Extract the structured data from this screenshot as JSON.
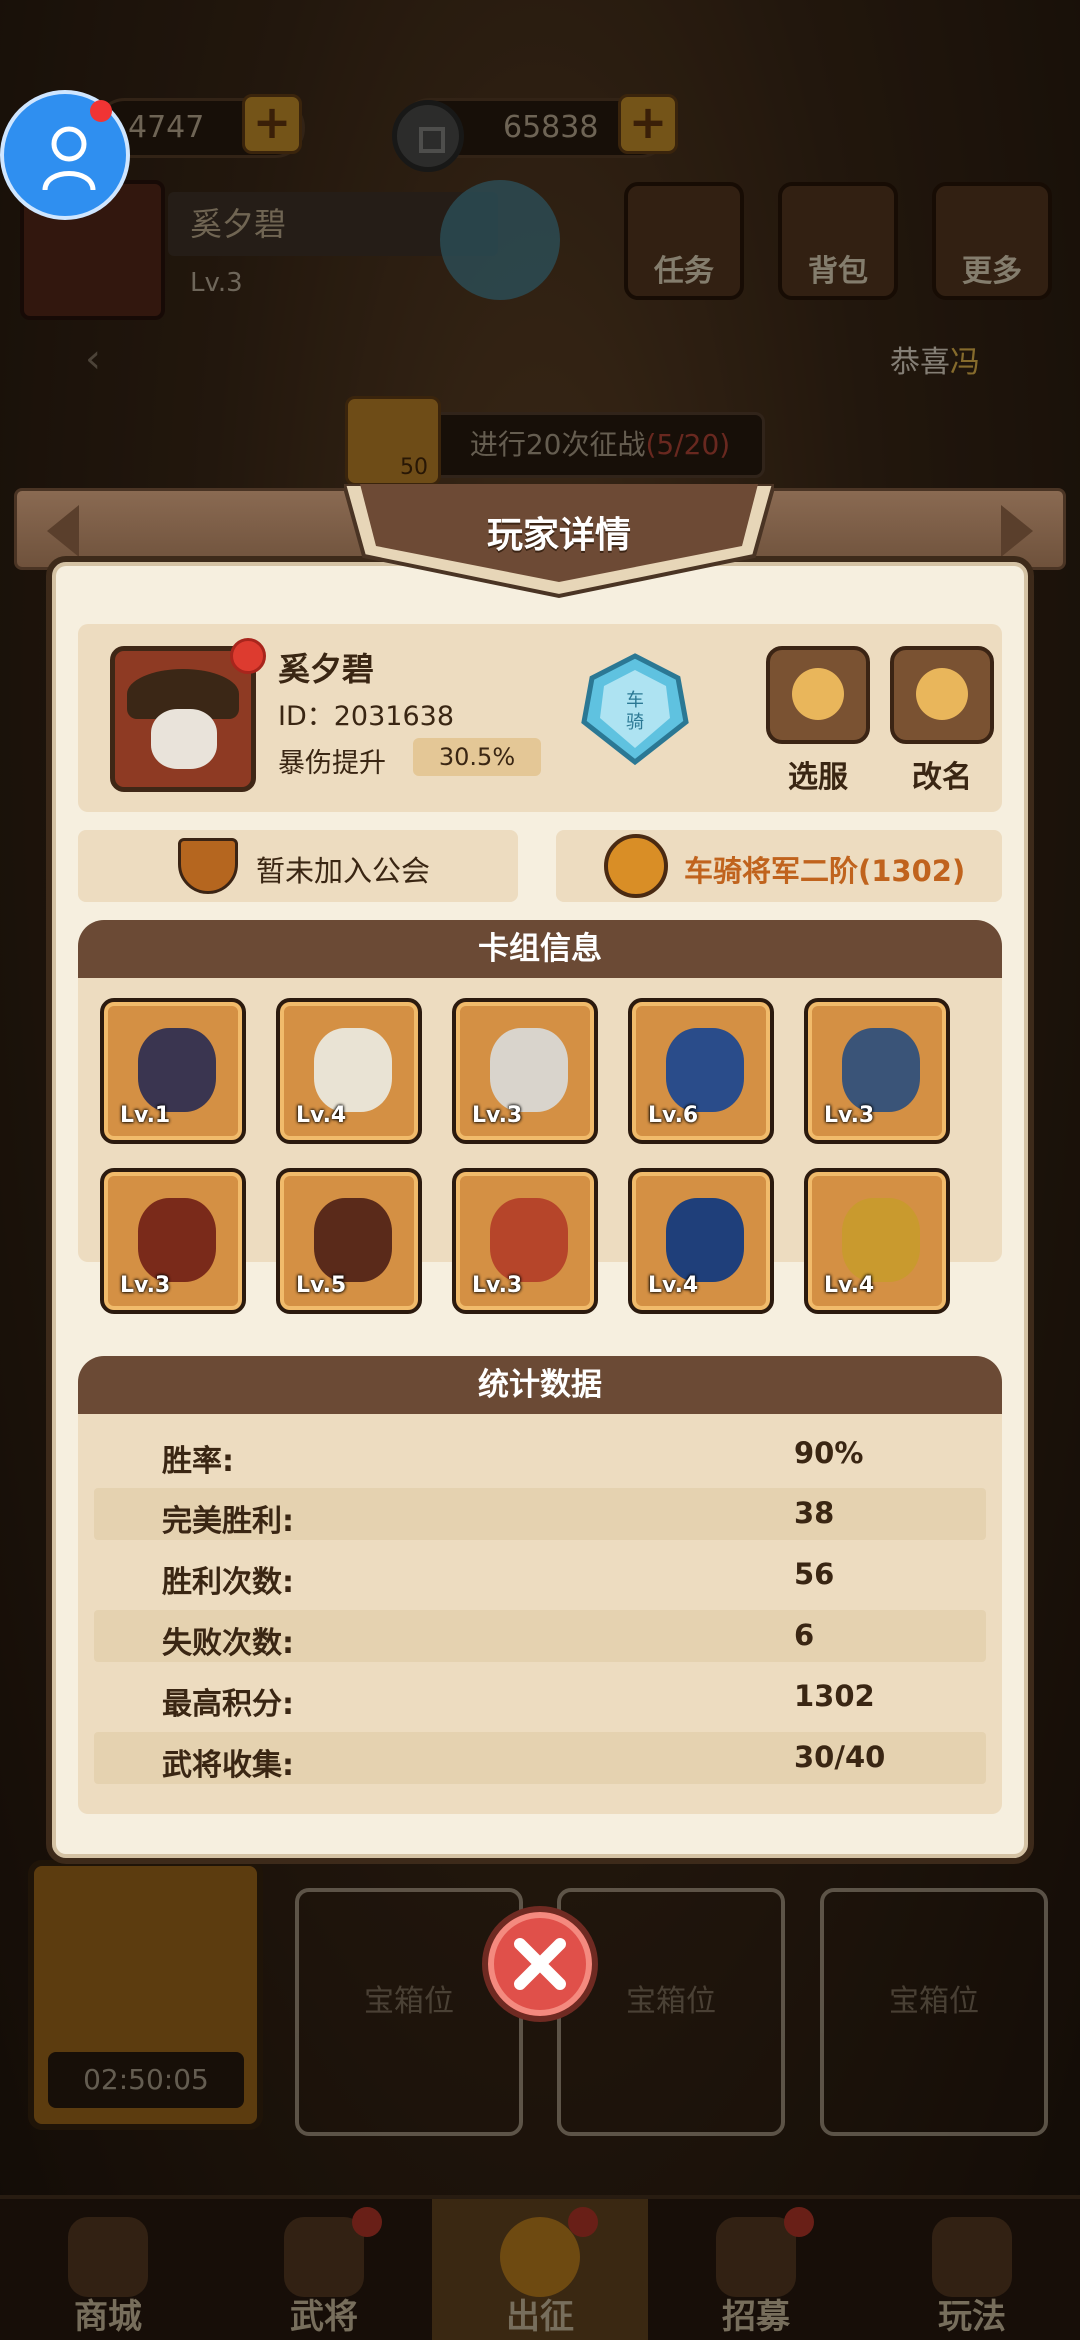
{
  "background": {
    "resources": [
      {
        "value": "4747"
      },
      {
        "value": "65838"
      }
    ],
    "player_name": "奚夕碧",
    "player_level": "Lv.3",
    "menu": [
      "任务",
      "背包",
      "更多"
    ],
    "congrats_prefix": "恭喜",
    "congrats_name": "冯",
    "quest_reward": "50",
    "quest_text": "进行20次征战",
    "quest_progress": "(5/20)",
    "chest_timer": "02:50:05",
    "chest_slots": [
      "宝箱位",
      "宝箱位",
      "宝箱位"
    ],
    "nav": [
      "商城",
      "武将",
      "出征",
      "招募",
      "玩法"
    ]
  },
  "modal": {
    "title": "玩家详情",
    "player": {
      "name": "奚夕碧",
      "id_label": "ID：2031638",
      "crit_label": "暴伤提升",
      "crit_value": "30.5%",
      "emblem_text": "车骑"
    },
    "buttons": {
      "server": "选服",
      "rename": "改名"
    },
    "guild_text": "暂未加入公会",
    "rank_text": "车骑将军二阶(1302)",
    "deck_title": "卡组信息",
    "deck": [
      {
        "level": "Lv.1",
        "color": "#3a3550"
      },
      {
        "level": "Lv.4",
        "color": "#e9e3d4"
      },
      {
        "level": "Lv.3",
        "color": "#d9d4cc"
      },
      {
        "level": "Lv.6",
        "color": "#2a4c8a"
      },
      {
        "level": "Lv.3",
        "color": "#3a5478"
      },
      {
        "level": "Lv.3",
        "color": "#7a2a1a"
      },
      {
        "level": "Lv.5",
        "color": "#5a2a1a"
      },
      {
        "level": "Lv.3",
        "color": "#b6452a"
      },
      {
        "level": "Lv.4",
        "color": "#1f3f7a"
      },
      {
        "level": "Lv.4",
        "color": "#c99a2e"
      }
    ],
    "stats_title": "统计数据",
    "stats": [
      {
        "label": "胜率:",
        "value": "90%"
      },
      {
        "label": "完美胜利:",
        "value": "38"
      },
      {
        "label": "胜利次数:",
        "value": "56"
      },
      {
        "label": "失败次数:",
        "value": "6"
      },
      {
        "label": "最高积分:",
        "value": "1302"
      },
      {
        "label": "武将收集:",
        "value": "30/40"
      }
    ]
  },
  "colors": {
    "panel_bg": "#f6efdf",
    "card_bg": "#eddcc0",
    "header_brown": "#6b4a35",
    "close_red": "#e0504a",
    "rank_orange": "#c0631d"
  }
}
